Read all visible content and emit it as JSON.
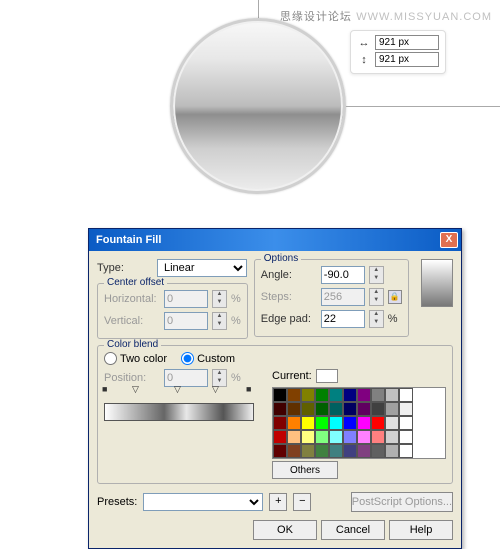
{
  "watermark": {
    "cn": "思缘设计论坛",
    "en": "WWW.MISSYUAN.COM"
  },
  "dimensions": {
    "w_icon": "↔",
    "w": "921 px",
    "h_icon": "↕",
    "h": "921 px"
  },
  "dialog": {
    "title": "Fountain Fill",
    "close": "X",
    "type_label": "Type:",
    "type_value": "Linear",
    "center_offset": {
      "title": "Center offset",
      "horiz_label": "Horizontal:",
      "horiz": "0",
      "vert_label": "Vertical:",
      "vert": "0"
    },
    "options": {
      "title": "Options",
      "angle_label": "Angle:",
      "angle": "-90.0",
      "steps_label": "Steps:",
      "steps": "256",
      "edge_label": "Edge pad:",
      "edge": "22"
    },
    "color_blend": {
      "title": "Color blend",
      "two_color": "Two color",
      "custom": "Custom",
      "position_label": "Position:",
      "position": "0",
      "current_label": "Current:",
      "others": "Others"
    },
    "presets_label": "Presets:",
    "postscript": "PostScript Options...",
    "buttons": {
      "ok": "OK",
      "cancel": "Cancel",
      "help": "Help"
    },
    "pct": "%",
    "plus": "+",
    "minus": "−"
  },
  "swatch_colors": [
    "#000",
    "#804000",
    "#808000",
    "#008000",
    "#008080",
    "#000080",
    "#800080",
    "#808080",
    "#c0c0c0",
    "#fff",
    "#400000",
    "#603000",
    "#606000",
    "#006000",
    "#006060",
    "#000060",
    "#600060",
    "#404040",
    "#a0a0a0",
    "#f0f0f0",
    "#800000",
    "#ff8000",
    "#ffff00",
    "#00ff00",
    "#00ffff",
    "#0000ff",
    "#ff00ff",
    "#ff0000",
    "#e0e0e0",
    "#fff",
    "#c00000",
    "#ffc080",
    "#ffff80",
    "#80ff80",
    "#80ffff",
    "#8080ff",
    "#ff80ff",
    "#ff8080",
    "#d0d0d0",
    "#fff",
    "#600000",
    "#804020",
    "#808040",
    "#408040",
    "#408080",
    "#404080",
    "#804080",
    "#606060",
    "#b0b0b0",
    "#fff"
  ]
}
